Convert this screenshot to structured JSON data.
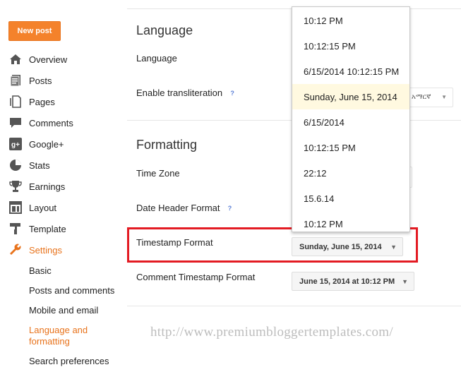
{
  "sidebar": {
    "new_post_label": "New post",
    "items": [
      {
        "label": "Overview",
        "icon": "home-icon"
      },
      {
        "label": "Posts",
        "icon": "posts-icon"
      },
      {
        "label": "Pages",
        "icon": "pages-icon"
      },
      {
        "label": "Comments",
        "icon": "comments-icon"
      },
      {
        "label": "Google+",
        "icon": "google-plus-icon"
      },
      {
        "label": "Stats",
        "icon": "stats-icon"
      },
      {
        "label": "Earnings",
        "icon": "earnings-icon"
      },
      {
        "label": "Layout",
        "icon": "layout-icon"
      },
      {
        "label": "Template",
        "icon": "template-icon"
      },
      {
        "label": "Settings",
        "icon": "wrench-icon"
      }
    ],
    "subitems": [
      {
        "label": "Basic"
      },
      {
        "label": "Posts and comments"
      },
      {
        "label": "Mobile and email"
      },
      {
        "label": "Language and formatting"
      },
      {
        "label": "Search preferences"
      }
    ]
  },
  "language": {
    "title": "Language",
    "language_label": "Language",
    "transliteration_label": "Enable transliteration",
    "transliteration_value": "አማርኛ",
    "help_glyph": "?"
  },
  "formatting": {
    "title": "Formatting",
    "timezone_label": "Time Zone",
    "date_header_label": "Date Header Format",
    "timestamp_label": "Timestamp Format",
    "timestamp_value": "Sunday, June 15, 2014",
    "comment_timestamp_label": "Comment Timestamp Format",
    "comment_timestamp_value": "June 15, 2014 at 10:12 PM"
  },
  "dropdown": {
    "options": [
      "10:12 PM",
      "10:12:15 PM",
      "6/15/2014 10:12:15 PM",
      "Sunday, June 15, 2014",
      "6/15/2014",
      "10:12:15 PM",
      "22:12",
      "15.6.14",
      "10:12 PM"
    ],
    "selected": "Sunday, June 15, 2014"
  },
  "watermark": "http://www.premiumbloggertemplates.com/",
  "colors": {
    "accent": "#e8731c",
    "button": "#f4822b",
    "highlight_border": "#e31b23",
    "selected_option": "#fff9e0"
  }
}
